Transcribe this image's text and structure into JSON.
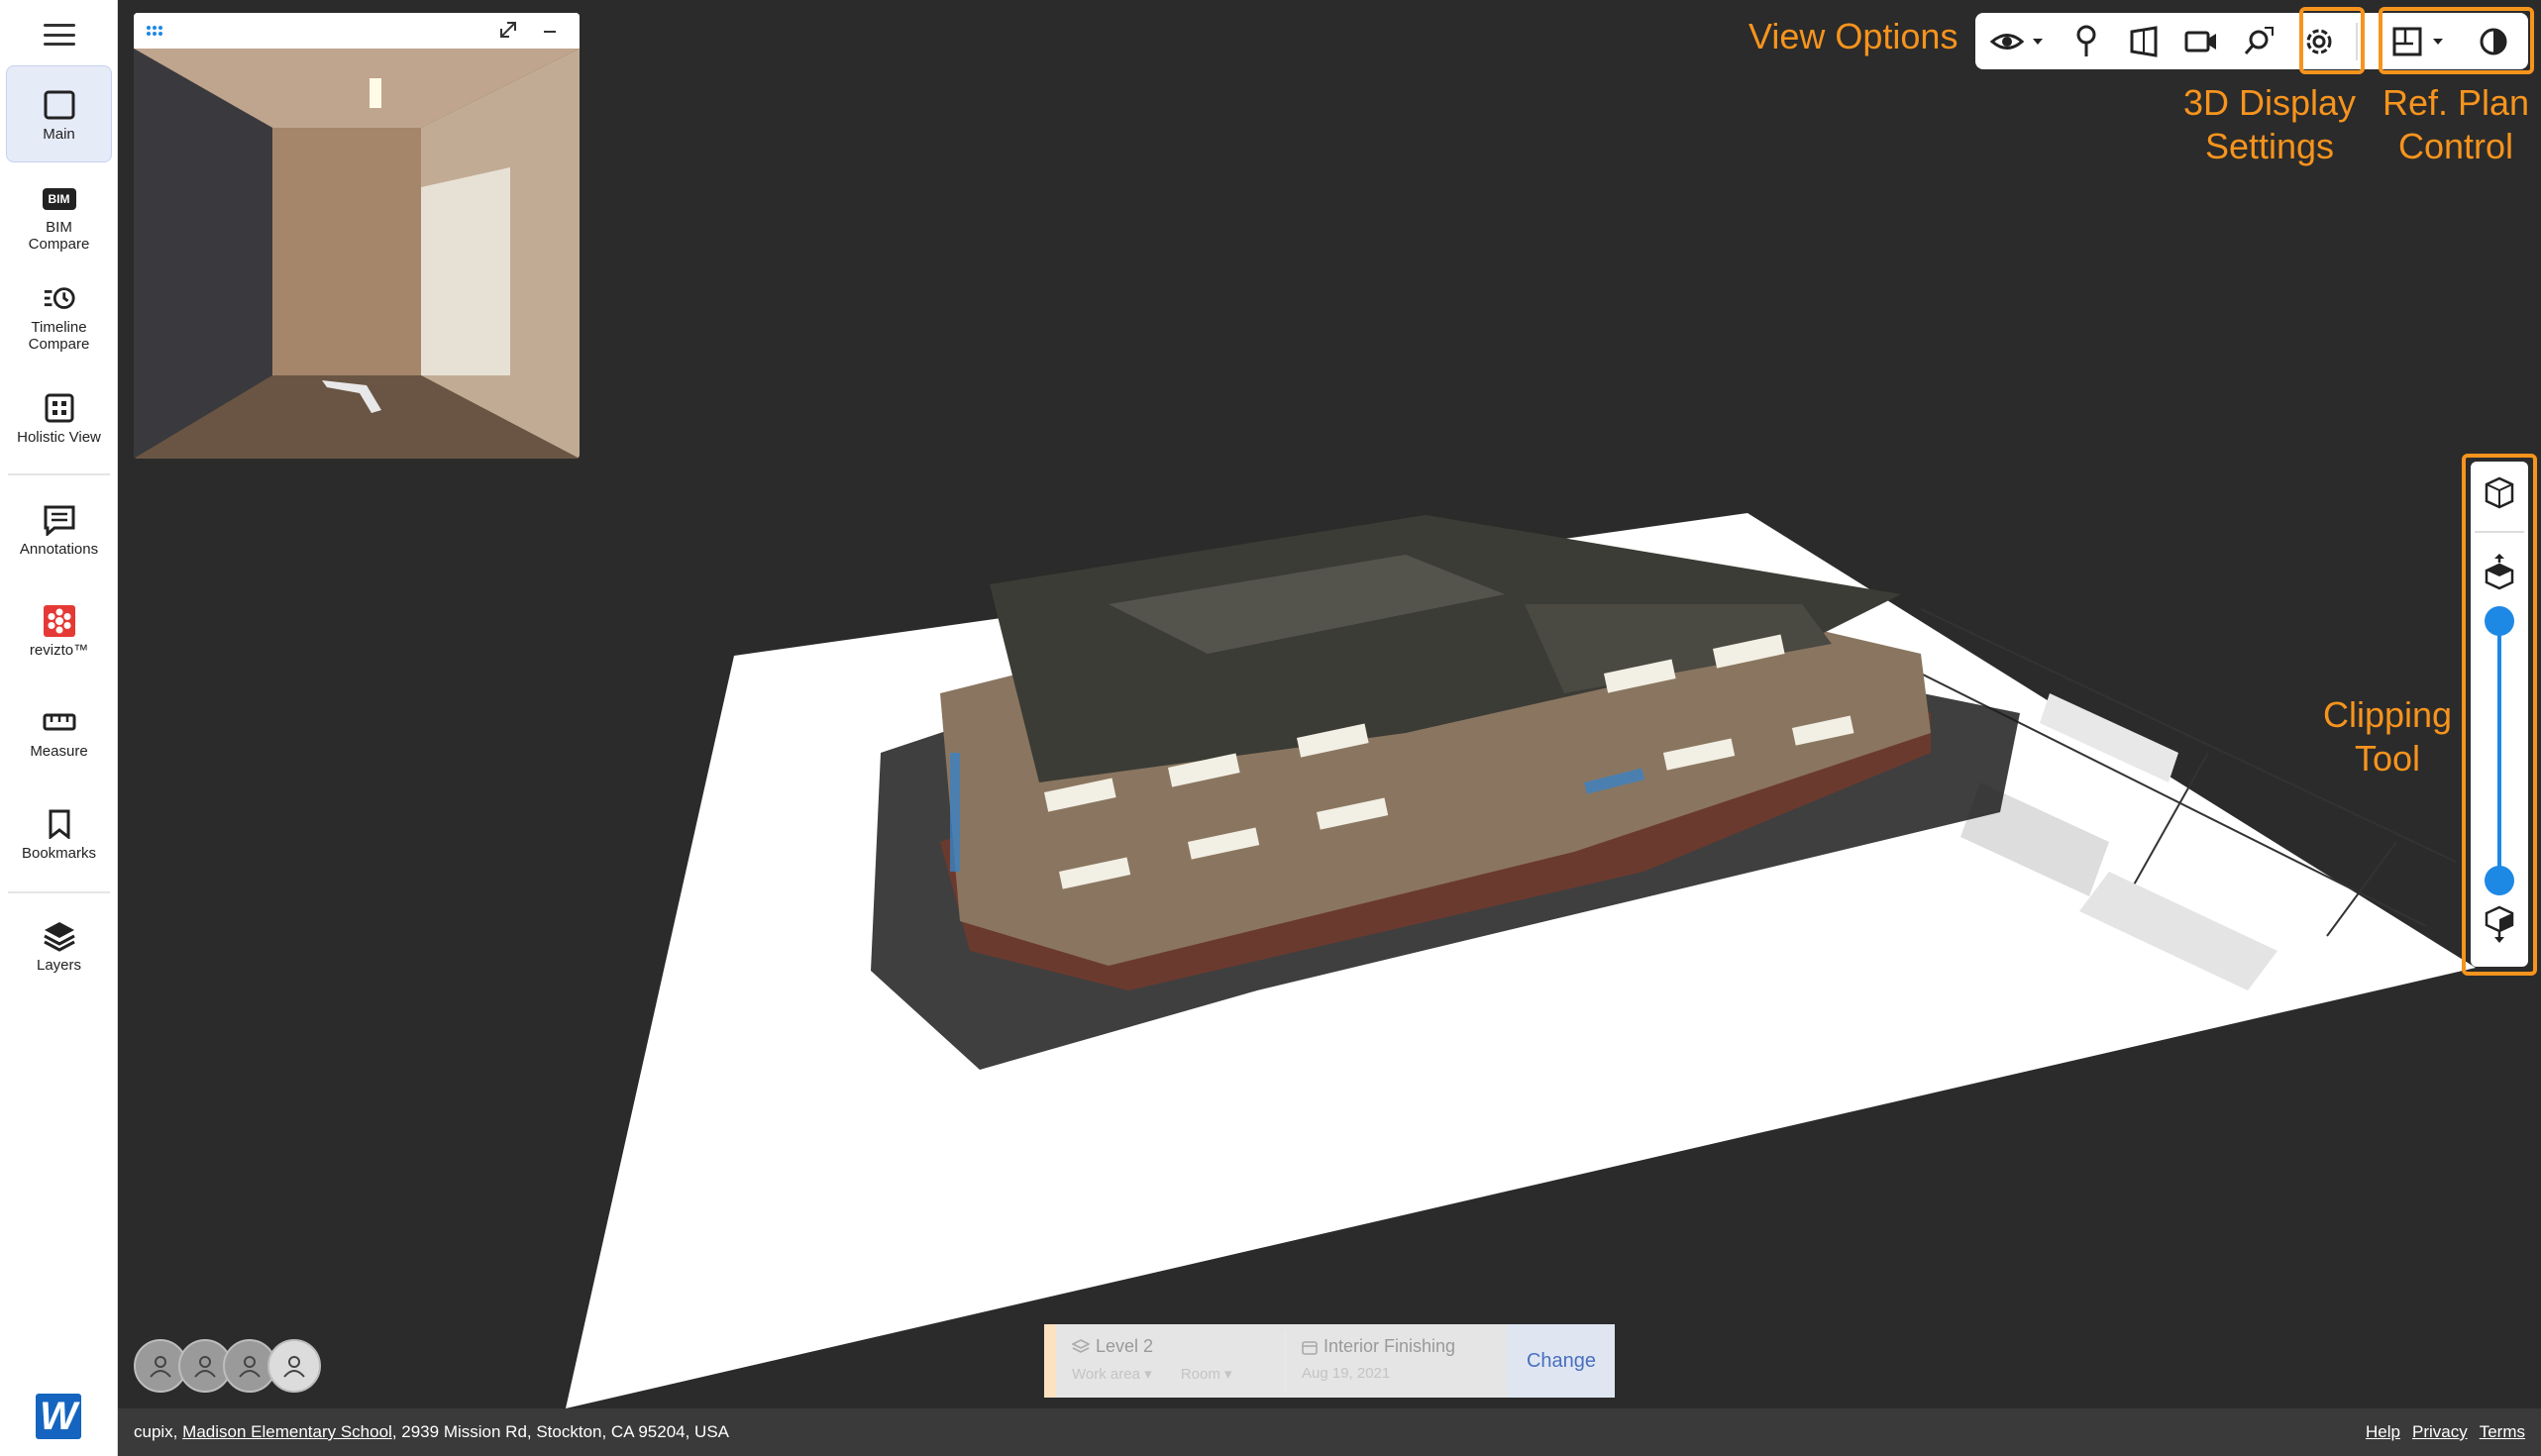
{
  "sidebar": {
    "items": [
      {
        "label": "Main",
        "icon": "square-icon"
      },
      {
        "label": "BIM Compare",
        "icon": "bim-icon"
      },
      {
        "label": "Timeline Compare",
        "icon": "timeline-icon"
      },
      {
        "label": "Holistic View",
        "icon": "grid-icon"
      },
      {
        "label": "Annotations",
        "icon": "annotation-icon"
      },
      {
        "label": "revizto™",
        "icon": "revizto-icon"
      },
      {
        "label": "Measure",
        "icon": "ruler-icon"
      },
      {
        "label": "Bookmarks",
        "icon": "bookmark-icon"
      },
      {
        "label": "Layers",
        "icon": "layers-icon"
      }
    ],
    "bim_badge": "BIM",
    "logo_letter": "W"
  },
  "annotations": {
    "view_options": "View Options",
    "display_settings_line1": "3D Display",
    "display_settings_line2": "Settings",
    "ref_plan_line1": "Ref. Plan",
    "ref_plan_line2": "Control",
    "clipping_line1": "Clipping",
    "clipping_line2": "Tool"
  },
  "level_card": {
    "level": "Level 2",
    "work_area": "Work area",
    "room": "Room",
    "phase": "Interior Finishing",
    "date": "Aug 19, 2021",
    "change_label": "Change"
  },
  "footer": {
    "company": "cupix,",
    "project": "Madison Elementary School",
    "address": ", 2939 Mission Rd, Stockton, CA 95204, USA",
    "links": [
      "Help",
      "Privacy",
      "Terms"
    ]
  },
  "colors": {
    "accent_orange": "#f7941d",
    "slider_blue": "#1e88e5",
    "active_nav": "#e6ebf8"
  }
}
